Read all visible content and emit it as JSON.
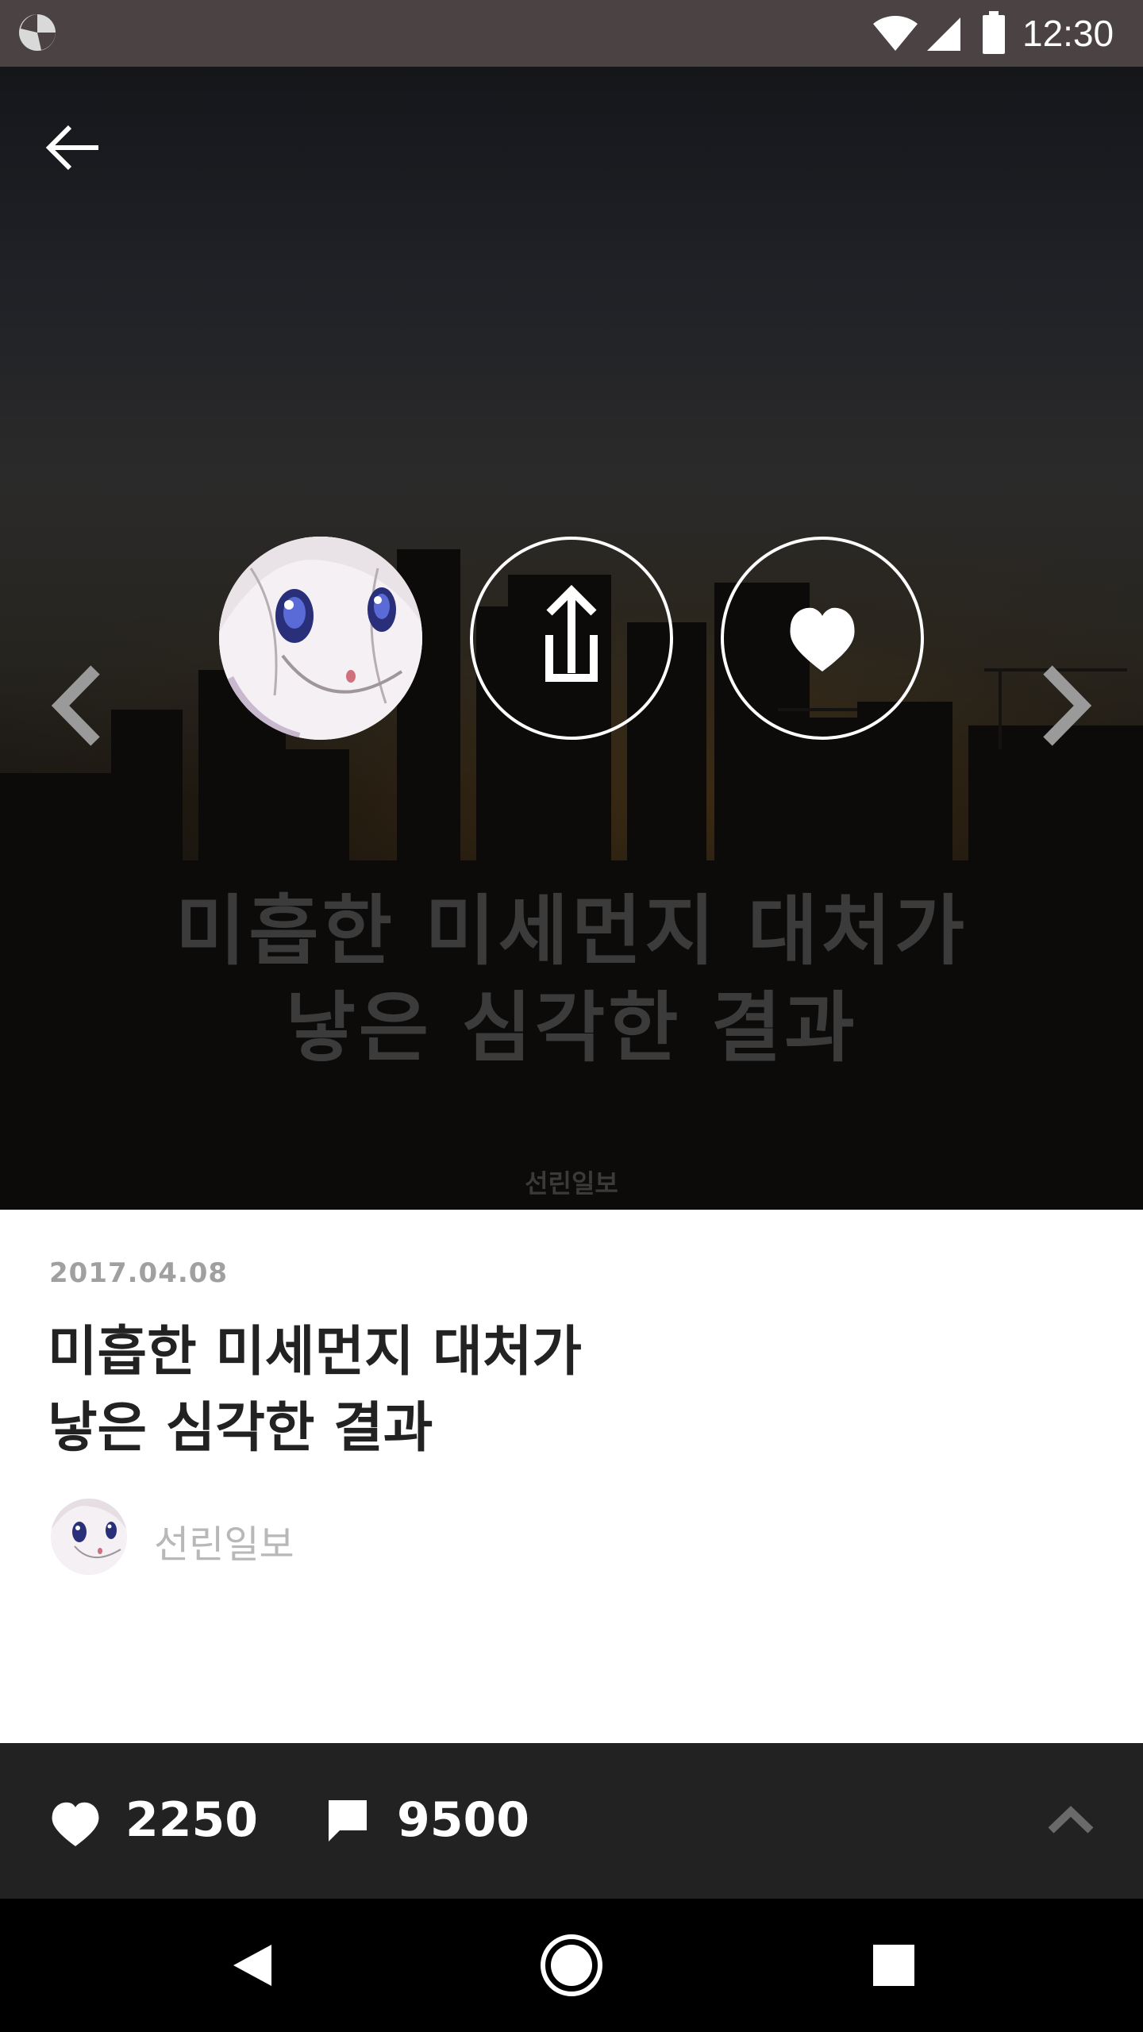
{
  "status_bar": {
    "time": "12:30",
    "icons": [
      "app-logo-icon",
      "wifi-icon",
      "signal-icon",
      "battery-icon"
    ]
  },
  "hero": {
    "title_line1": "미흡한 미세먼지 대처가",
    "title_line2": "낳은 심각한 결과",
    "source": "선린일보",
    "icons": [
      "back-arrow-icon",
      "chevron-left-icon",
      "share-icon",
      "heart-icon",
      "chevron-right-icon"
    ]
  },
  "article": {
    "date": "2017.04.08",
    "title_line1": "미흡한 미세먼지 대처가",
    "title_line2": "낳은 심각한 결과",
    "author": "선린일보"
  },
  "action_bar": {
    "like_count": "2250",
    "comment_count": "9500",
    "icons": [
      "heart-icon",
      "comment-icon",
      "chevron-up-icon"
    ]
  },
  "nav_bar": {
    "icons": [
      "nav-back-icon",
      "nav-home-icon",
      "nav-recents-icon"
    ]
  },
  "colors": {
    "status_bar": "#4a4243",
    "action_bar": "#222222",
    "nav_bar": "#000000",
    "date_text": "#a0a0a0",
    "author_text": "#b8b8b8"
  }
}
